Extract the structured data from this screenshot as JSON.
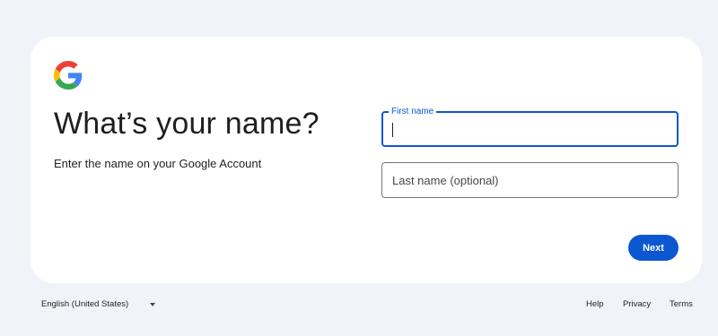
{
  "card": {
    "title": "What’s your name?",
    "subtitle": "Enter the name on your Google Account",
    "first_name": {
      "label": "First name",
      "value": ""
    },
    "last_name": {
      "placeholder": "Last name (optional)",
      "value": ""
    },
    "next_label": "Next"
  },
  "footer": {
    "language": "English (United States)",
    "help": "Help",
    "privacy": "Privacy",
    "terms": "Terms"
  },
  "colors": {
    "accent": "#0b57d0",
    "background": "#f0f4f9",
    "card": "#ffffff"
  },
  "icons": [
    "google-logo-icon",
    "chevron-down-icon"
  ]
}
